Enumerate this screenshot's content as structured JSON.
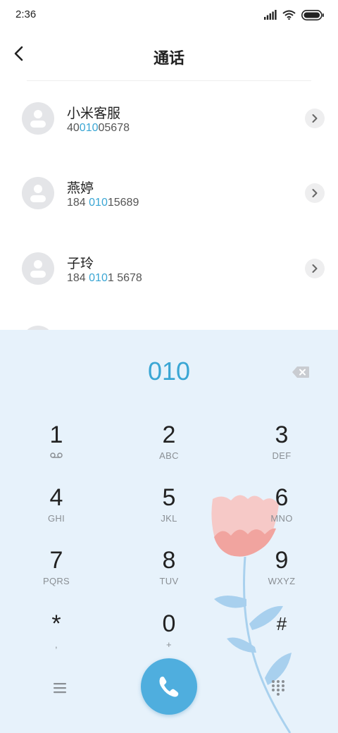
{
  "status_bar": {
    "time": "2:36"
  },
  "header": {
    "title": "通话"
  },
  "contacts": [
    {
      "name": "小米客服",
      "number_pre": "40",
      "number_match": "010",
      "number_post": "05678"
    },
    {
      "name": "燕婷",
      "number_pre": "184 ",
      "number_match": "010",
      "number_post": "15689"
    },
    {
      "name": "子玲",
      "number_pre": "184 ",
      "number_match": "010",
      "number_post": "1 5678"
    }
  ],
  "dialer": {
    "input": "010",
    "keys": [
      {
        "digit": "1",
        "letters": ""
      },
      {
        "digit": "2",
        "letters": "ABC"
      },
      {
        "digit": "3",
        "letters": "DEF"
      },
      {
        "digit": "4",
        "letters": "GHI"
      },
      {
        "digit": "5",
        "letters": "JKL"
      },
      {
        "digit": "6",
        "letters": "MNO"
      },
      {
        "digit": "7",
        "letters": "PQRS"
      },
      {
        "digit": "8",
        "letters": "TUV"
      },
      {
        "digit": "9",
        "letters": "WXYZ"
      },
      {
        "digit": "*",
        "letters": ","
      },
      {
        "digit": "0",
        "letters": "+"
      },
      {
        "digit": "#",
        "letters": ""
      }
    ]
  },
  "colors": {
    "accent": "#3aa6d4",
    "dialpad_background": "#e7f2fb",
    "call_button": "#4faede",
    "flower_petal": "#f4a7a0"
  },
  "icons": {
    "back": "back-arrow-icon",
    "backspace": "backspace-icon",
    "voicemail": "voicemail-icon",
    "menu": "menu-icon",
    "call": "phone-icon",
    "keypad": "keypad-icon",
    "chevron": "chevron-right-icon"
  }
}
